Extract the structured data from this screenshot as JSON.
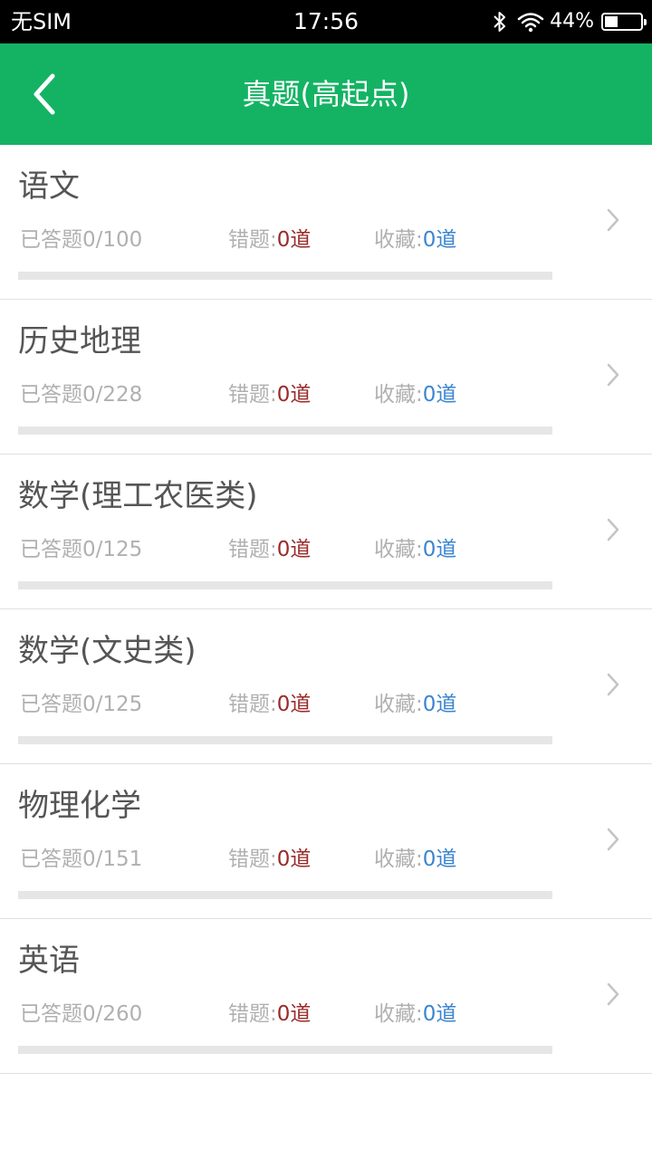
{
  "status_bar": {
    "carrier": "无SIM",
    "time": "17:56",
    "battery_percent": "44%",
    "battery_level": 0.44,
    "icons": [
      "bluetooth-icon",
      "wifi-icon",
      "battery-icon"
    ]
  },
  "nav": {
    "title": "真题(高起点)",
    "back_icon": "chevron-left-icon",
    "background_color": "#14b364"
  },
  "labels": {
    "answered": "已答题",
    "wrong": "错题:",
    "favorite": "收藏:"
  },
  "colors": {
    "wrong_value": "#9a2a2a",
    "favorite_value": "#3b85d0"
  },
  "subjects": [
    {
      "name": "语文",
      "answered": "0/100",
      "wrong": "0道",
      "favorite": "0道",
      "progress": 0
    },
    {
      "name": "历史地理",
      "answered": "0/228",
      "wrong": "0道",
      "favorite": "0道",
      "progress": 0
    },
    {
      "name": "数学(理工农医类)",
      "answered": "0/125",
      "wrong": "0道",
      "favorite": "0道",
      "progress": 0
    },
    {
      "name": "数学(文史类)",
      "answered": "0/125",
      "wrong": "0道",
      "favorite": "0道",
      "progress": 0
    },
    {
      "name": "物理化学",
      "answered": "0/151",
      "wrong": "0道",
      "favorite": "0道",
      "progress": 0
    },
    {
      "name": "英语",
      "answered": "0/260",
      "wrong": "0道",
      "favorite": "0道",
      "progress": 0
    }
  ]
}
